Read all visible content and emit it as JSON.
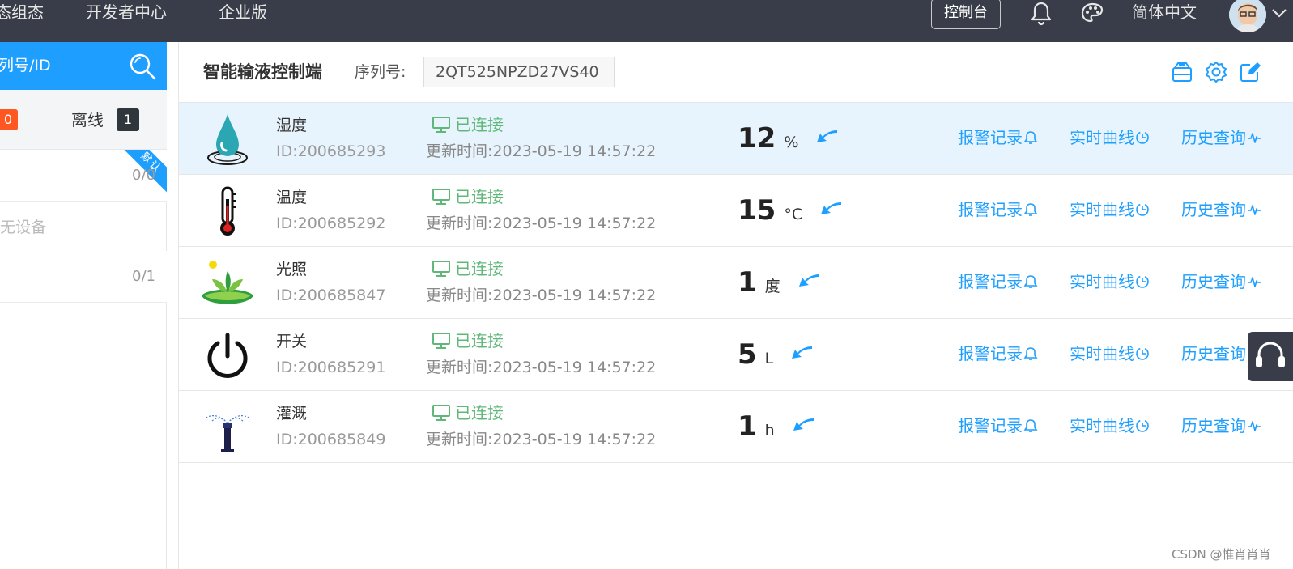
{
  "nav": {
    "items": [
      "态组态",
      "开发者中心",
      "企业版"
    ],
    "console_label": "控制台",
    "language_label": "简体中文",
    "icons": [
      "bell-icon",
      "palette-icon",
      "chevron-down-icon"
    ]
  },
  "sidebar": {
    "search_label": "列号/ID",
    "online_count": "0",
    "offline_label": "离线",
    "offline_count": "1",
    "groups": [
      {
        "count": "0/0",
        "ribbon": "默认"
      },
      {
        "count": "0/1"
      }
    ],
    "empty_text": "无设备"
  },
  "header": {
    "title": "智能输液控制端",
    "serial_label": "序列号:",
    "serial_value": "2QT525NPZD27VS40",
    "tool_icons": [
      "storage-icon",
      "settings-icon",
      "edit-icon"
    ]
  },
  "actions": {
    "alarm": "报警记录",
    "realtime": "实时曲线",
    "history": "历史查询"
  },
  "devices": [
    {
      "name": "湿度",
      "id": "ID:200685293",
      "status": "已连接",
      "updated": "更新时间:2023-05-19 14:57:22",
      "value": "12",
      "unit": "%",
      "icon": "water-drop-icon",
      "selected": true
    },
    {
      "name": "温度",
      "id": "ID:200685292",
      "status": "已连接",
      "updated": "更新时间:2023-05-19 14:57:22",
      "value": "15",
      "unit": "°C",
      "icon": "thermometer-icon",
      "selected": false
    },
    {
      "name": "光照",
      "id": "ID:200685847",
      "status": "已连接",
      "updated": "更新时间:2023-05-19 14:57:22",
      "value": "1",
      "unit": "度",
      "icon": "plant-sun-icon",
      "selected": false
    },
    {
      "name": "开关",
      "id": "ID:200685291",
      "status": "已连接",
      "updated": "更新时间:2023-05-19 14:57:22",
      "value": "5",
      "unit": "L",
      "icon": "power-icon",
      "selected": false
    },
    {
      "name": "灌溉",
      "id": "ID:200685849",
      "status": "已连接",
      "updated": "更新时间:2023-05-19 14:57:22",
      "value": "1",
      "unit": "h",
      "icon": "sprinkler-icon",
      "selected": false
    }
  ],
  "watermark": "CSDN @惟肖肖肖",
  "colors": {
    "topbar": "#393d49",
    "accent": "#1e9fff",
    "connected": "#5fb878",
    "alert": "#ff5722"
  }
}
